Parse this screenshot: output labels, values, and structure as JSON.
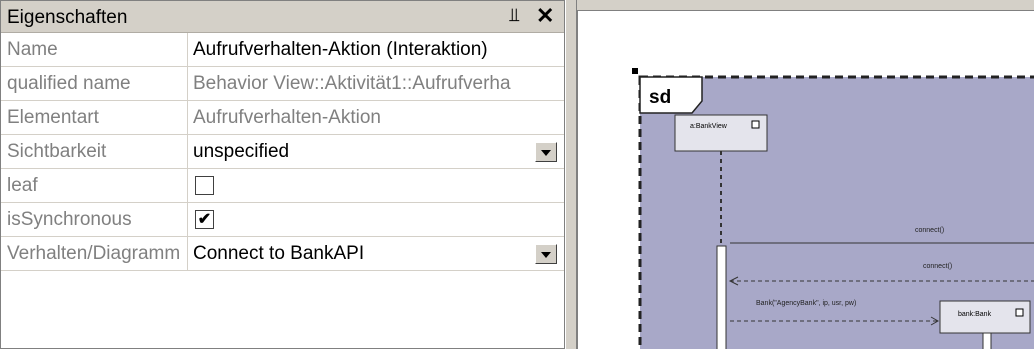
{
  "panel": {
    "title": "Eigenschaften",
    "pin_icon": "pin-icon",
    "close_icon": "close-icon"
  },
  "properties": [
    {
      "name": "Name",
      "value": "Aufrufverhalten-Aktion (Interaktion)",
      "type": "text"
    },
    {
      "name": "qualified name",
      "value": "Behavior View::Aktivität1::Aufrufverha",
      "type": "readonly"
    },
    {
      "name": "Elementart",
      "value": "Aufrufverhalten-Aktion",
      "type": "readonly"
    },
    {
      "name": "Sichtbarkeit",
      "value": "unspecified",
      "type": "dropdown"
    },
    {
      "name": "leaf",
      "value": "",
      "type": "checkbox",
      "checked": false
    },
    {
      "name": "isSynchronous",
      "value": "",
      "type": "checkbox",
      "checked": true
    },
    {
      "name": "Verhalten/Diagramm",
      "value": "Connect to BankAPI",
      "type": "dropdown"
    }
  ],
  "diagram": {
    "frame_label": "sd",
    "lifeline_1": "a:BankView",
    "lifeline_2": "bank:Bank",
    "msg_1": "connect()",
    "msg_2": "connect()",
    "msg_3": "Bank(\"AgencyBank\", ip, usr, pw)",
    "colors": {
      "frame_fill": "#a8a8c8",
      "box_fill": "#e4e4ec"
    }
  }
}
